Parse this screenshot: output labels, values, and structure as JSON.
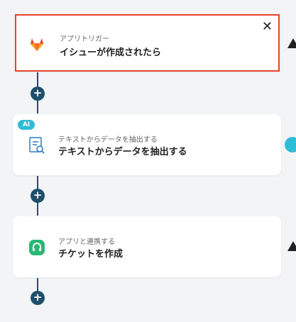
{
  "steps": [
    {
      "subtitle": "アプリトリガー",
      "title": "イシューが作成されたら"
    },
    {
      "subtitle": "テキストからデータを抽出する",
      "title": "テキストからデータを抽出する",
      "badge": "AI"
    },
    {
      "subtitle": "アプリと連携する",
      "title": "チケットを作成"
    }
  ],
  "add_symbol": "+",
  "close_symbol": "✕",
  "colors": {
    "selected_border": "#e8452b",
    "connector": "#1f4f6b",
    "ai_badge": "#2fbcd6",
    "gitlab": "#e24329",
    "ticket_app": "#2bb673"
  }
}
